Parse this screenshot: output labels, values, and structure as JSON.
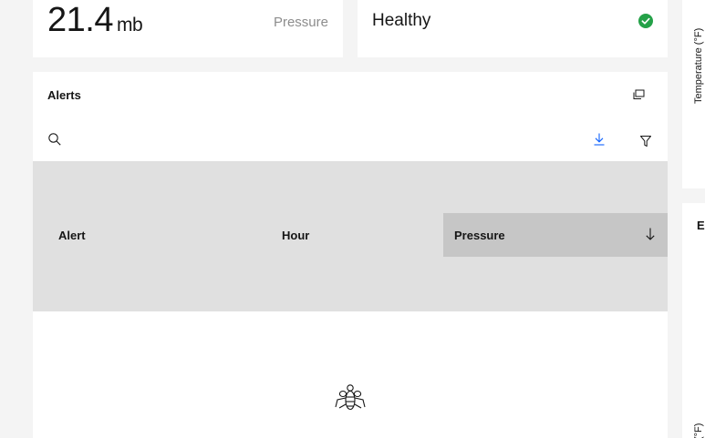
{
  "pressure_tile": {
    "value": "21.4",
    "unit": "mb",
    "label": "Pressure"
  },
  "health_tile": {
    "status": "Healthy",
    "status_icon": "checkmark-filled-icon",
    "status_color": "#24a148"
  },
  "side_charts": {
    "chart1_axis_label": "Temperature (°F)",
    "chart2_title_initial": "E",
    "chart2_axis_label": "(°F)"
  },
  "alerts": {
    "title": "Alerts",
    "toolbar": {
      "expand_icon": "expand-icon",
      "search_icon": "search-icon",
      "download_icon": "download-icon",
      "filter_icon": "filter-icon",
      "download_color": "#0f62fe"
    },
    "columns": [
      {
        "label": "Alert"
      },
      {
        "label": "Hour"
      },
      {
        "label": "Pressure",
        "sorted": "descending"
      }
    ],
    "rows": [],
    "empty_state_icon": "bee-icon"
  }
}
